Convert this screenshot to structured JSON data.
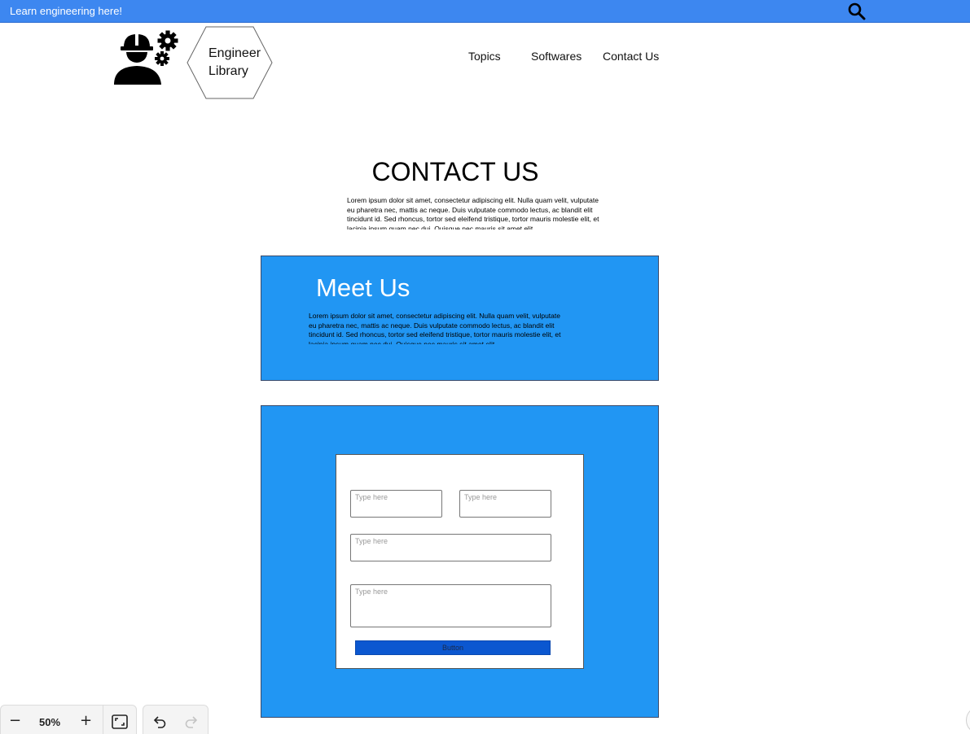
{
  "topbar": {
    "text": "Learn engineering here!"
  },
  "brand": {
    "line1": "Engineer",
    "line2": "Library"
  },
  "nav": {
    "topics": "Topics",
    "softwares": "Softwares",
    "contact": "Contact Us"
  },
  "contact": {
    "heading": "CONTACT US",
    "body": "Lorem ipsum dolor sit amet, consectetur adipiscing elit. Nulla quam velit, vulputate eu pharetra nec, mattis ac neque. Duis vulputate commodo lectus, ac blandit elit tincidunt id. Sed rhoncus, tortor sed eleifend tristique, tortor mauris molestie elit, et lacinia ipsum quam nec dui. Quisque nec mauris sit amet elit"
  },
  "meet": {
    "heading": "Meet Us",
    "body": "Lorem ipsum dolor sit amet, consectetur adipiscing elit. Nulla quam velit, vulputate eu pharetra nec, mattis ac neque. Duis vulputate commodo lectus, ac blandit elit tincidunt id. Sed rhoncus, tortor sed eleifend tristique, tortor mauris molestie elit, et lacinia ipsum quam nec dui. Quisque nec mauris sit amet elit"
  },
  "form": {
    "placeholder_1": "Type here",
    "placeholder_2": "Type here",
    "placeholder_3": "Type here",
    "placeholder_4": "Type here",
    "button": "Button"
  },
  "toolbar": {
    "zoom_level": "50%"
  },
  "colors": {
    "topbar": "#3d87f0",
    "panel": "#2196f3",
    "button": "#0b57d0"
  }
}
